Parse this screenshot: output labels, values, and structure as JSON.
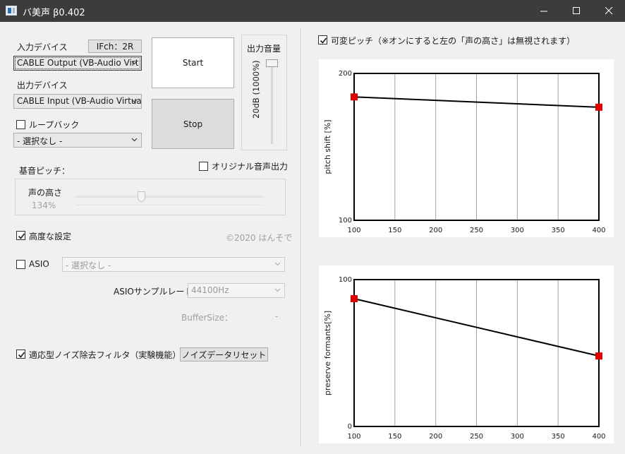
{
  "window": {
    "title": "バ美声 β0.402",
    "controls": [
      "minimize",
      "maximize",
      "close"
    ]
  },
  "input_device": {
    "label": "入力デバイス",
    "ifch_badge": "IFch：2R",
    "selected": "CABLE Output (VB-Audio Virt"
  },
  "output_device": {
    "label": "出力デバイス",
    "selected": "CABLE Input (VB-Audio Virtua"
  },
  "loopback": {
    "label": "ループバック",
    "checked": false,
    "selected": "- 選択なし -"
  },
  "buttons": {
    "start": "Start",
    "stop": "Stop",
    "noise_reset": "ノイズデータリセット"
  },
  "output_volume": {
    "label": "出力音量",
    "value_text": "20dB (1000%)",
    "level": 1.0
  },
  "original_output": {
    "label": "オリジナル音声出力",
    "checked": false
  },
  "base_pitch": {
    "label": "基音ピッチ：",
    "voice_height_label": "声の高さ",
    "voice_height_value": "134%",
    "slider_position": 0.35
  },
  "advanced": {
    "label": "高度な設定",
    "checked": true,
    "copyright": "©2020 はんそで"
  },
  "asio": {
    "label": "ASIO",
    "checked": false,
    "selected": "- 選択なし -",
    "sample_rate_label": "ASIOサンプルレート：",
    "sample_rate_value": "44100Hz",
    "buffer_size_label": "BufferSize：",
    "buffer_size_value": "-"
  },
  "noise_filter": {
    "label": "適応型ノイズ除去フィルタ（実験機能）",
    "checked": true
  },
  "variable_pitch": {
    "label": "可変ピッチ（※オンにすると左の「声の高さ」は無視されます）",
    "checked": true
  },
  "colors": {
    "titlebar": "#3c3c3c",
    "point": "#e00000",
    "grid": "#a0a0a0"
  },
  "chart_data": [
    {
      "type": "line",
      "ylabel": "pitch shift [%]",
      "x_ticks": [
        "100",
        "150",
        "200",
        "250",
        "300",
        "350",
        "400"
      ],
      "y_ticks": [
        "100",
        "200"
      ],
      "xlim": [
        100,
        400
      ],
      "ylim": [
        100,
        200
      ],
      "x": [
        100,
        400
      ],
      "y": [
        184,
        177
      ]
    },
    {
      "type": "line",
      "ylabel": "preserve formants[%]",
      "x_ticks": [
        "100",
        "150",
        "200",
        "250",
        "300",
        "350",
        "400"
      ],
      "y_ticks": [
        "0",
        "100"
      ],
      "xlim": [
        100,
        400
      ],
      "ylim": [
        0,
        100
      ],
      "x": [
        100,
        400
      ],
      "y": [
        87,
        48
      ]
    }
  ]
}
